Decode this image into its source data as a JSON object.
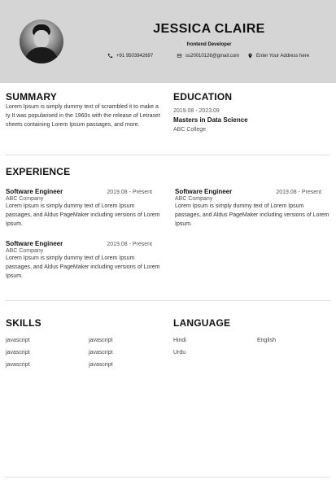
{
  "header": {
    "name": "JESSICA CLAIRE",
    "role": "frontend Developer",
    "phone": "+91 9503942697",
    "email": "ss20010126@gmail.com",
    "address": "Enter Your Address here",
    "icons": {
      "phone": "phone-icon",
      "email": "envelope-icon",
      "address": "location-pin-icon"
    }
  },
  "summary": {
    "title": "SUMMARY",
    "text": "Lorem Ipsum is simply dummy text of scrambled it to make a ty It was popularised in the 1960s with the release of Letraset sheets containing Lorem Ipsum passages, and more."
  },
  "education": {
    "title": "EDUCATION",
    "date": "2019.08 - 2023.09",
    "degree": "Masters in Data Science",
    "college": "ABC College"
  },
  "experience": {
    "title": "EXPERIENCE",
    "items": [
      {
        "title": "Software Engineer",
        "date": "2019.08 - Present",
        "company": "ABC Company",
        "description": "Lorem Ipsum is simply dummy text of Lorem Ipsum passages, and Aldus PageMaker including versions of Lorem Ipsum."
      },
      {
        "title": "Software Engineer",
        "date": "2019.08 - Present",
        "company": "ABC Company",
        "description": "Lorem Ipsum is simply dummy text of Lorem Ipsum passages, and Aldus PageMaker including versions of Lorem Ipsum."
      },
      {
        "title": "Software Engineer",
        "date": "2019.08 - Present",
        "company": "ABC Company",
        "description": "Lorem Ipsum is simply dummy text of Lorem Ipsum passages, and Aldus PageMaker including versions of Lorem Ipsum."
      }
    ]
  },
  "skills": {
    "title": "SKILLS",
    "items": [
      "javascript",
      "javascript",
      "javascript",
      "javascript",
      "javascript",
      "javascript"
    ]
  },
  "language": {
    "title": "LANGUAGE",
    "items": [
      "Hindi",
      "English",
      "Urdu"
    ]
  },
  "colors": {
    "header_background": "#d6d5d6",
    "text": "#222222",
    "divider": "#e1e1e1"
  }
}
